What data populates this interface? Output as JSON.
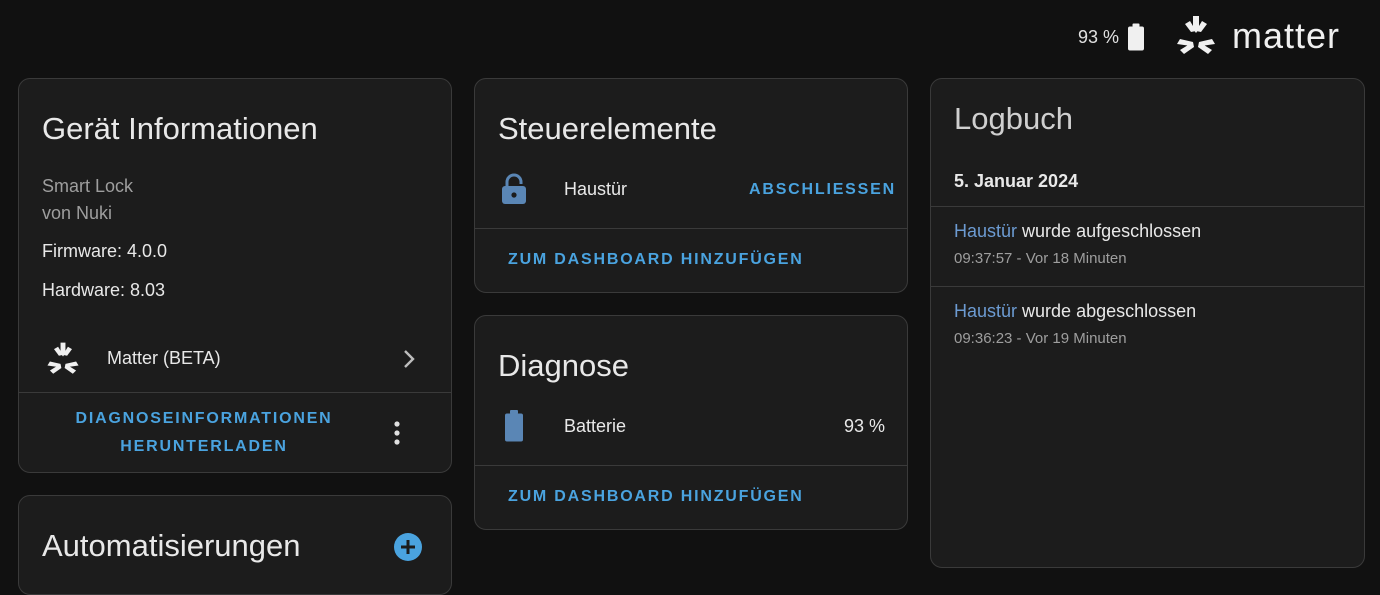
{
  "topbar": {
    "battery_text": "93 %",
    "brand_name": "matter",
    "brand_icon": "matter-logo-icon",
    "battery_icon": "battery-full-icon"
  },
  "device_info": {
    "title": "Gerät Informationen",
    "model": "Smart Lock",
    "manufacturer": "von Nuki",
    "firmware": "Firmware: 4.0.0",
    "hardware": "Hardware: 8.03",
    "integration_label": "Matter (BETA)",
    "integration_icon": "matter-logo-icon",
    "download_label_line1": "DIAGNOSEINFORMATIONEN",
    "download_label_line2": "HERUNTERLADEN",
    "more_icon": "more-vertical-icon"
  },
  "automations": {
    "title": "Automatisierungen",
    "add_icon": "plus-circle-icon"
  },
  "controls": {
    "title": "Steuerelemente",
    "entity_name": "Haustür",
    "entity_icon": "lock-open-icon",
    "action_label": "ABSCHLIESSEN",
    "add_to_dashboard": "ZUM DASHBOARD HINZUFÜGEN"
  },
  "diagnostics": {
    "title": "Diagnose",
    "entity_name": "Batterie",
    "entity_icon": "battery-icon",
    "entity_value": "93 %",
    "add_to_dashboard": "ZUM DASHBOARD HINZUFÜGEN"
  },
  "logbook": {
    "title": "Logbuch",
    "date": "5. Januar 2024",
    "entries": [
      {
        "entity": "Haustür",
        "message": "wurde aufgeschlossen",
        "time": "09:37:57 - Vor 18 Minuten"
      },
      {
        "entity": "Haustür",
        "message": "wurde abgeschlossen",
        "time": "09:36:23 - Vor 19 Minuten"
      }
    ]
  },
  "colors": {
    "background": "#111111",
    "card": "#1c1c1c",
    "accent": "#4aa3df",
    "icon_blue": "#5a86b5",
    "link_muted": "#6c9bd2"
  }
}
